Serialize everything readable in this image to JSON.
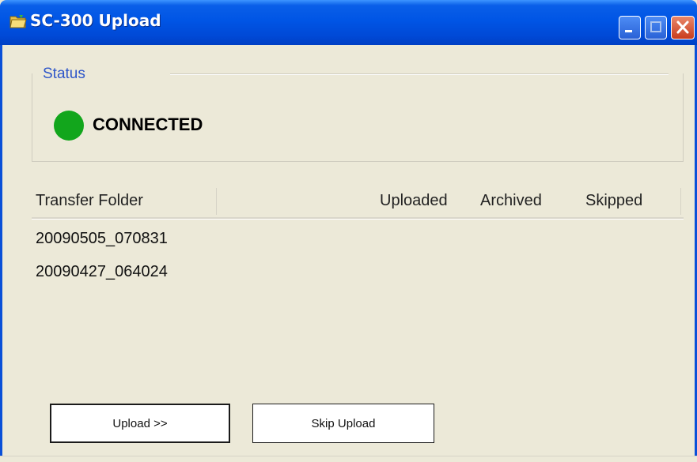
{
  "window": {
    "title": "SC-300 Upload"
  },
  "status": {
    "group_label": "Status",
    "state": "CONNECTED",
    "indicator_color": "#12a61c"
  },
  "table": {
    "columns": [
      "Transfer Folder",
      "Uploaded",
      "Archived",
      "Skipped"
    ],
    "rows": [
      {
        "folder": "20090505_070831",
        "uploaded": "",
        "archived": "",
        "skipped": ""
      },
      {
        "folder": "20090427_064024",
        "uploaded": "",
        "archived": "",
        "skipped": ""
      }
    ]
  },
  "buttons": {
    "upload_label": "Upload >>",
    "skip_label": "Skip Upload"
  },
  "colors": {
    "titlebar": "#0055e5",
    "close_button": "#c93c1d",
    "background": "#ece9d8"
  }
}
